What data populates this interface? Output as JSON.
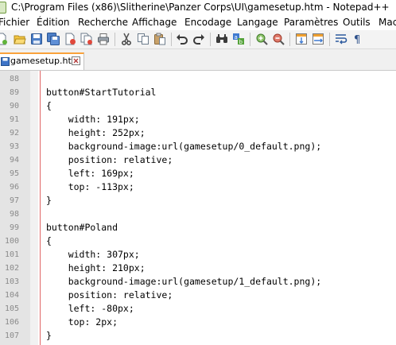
{
  "window": {
    "title": "C:\\Program Files (x86)\\Slitherine\\Panzer Corps\\UI\\gamesetup.htm - Notepad++"
  },
  "menu": {
    "items": [
      {
        "label": "Fichier"
      },
      {
        "label": "Édition"
      },
      {
        "label": "Recherche"
      },
      {
        "label": "Affichage"
      },
      {
        "label": "Encodage"
      },
      {
        "label": "Langage"
      },
      {
        "label": "Paramètres"
      },
      {
        "label": "Outils"
      },
      {
        "label": "Macro"
      }
    ]
  },
  "toolbar": {
    "icons": [
      "new-file-icon",
      "open-file-icon",
      "save-icon",
      "save-all-icon",
      "close-icon",
      "close-all-icon",
      "print-icon",
      "cut-icon",
      "copy-icon",
      "paste-icon",
      "undo-icon",
      "redo-icon",
      "find-icon",
      "replace-icon",
      "zoom-in-icon",
      "zoom-out-icon",
      "sync-vertical-icon",
      "sync-horizontal-icon",
      "word-wrap-icon",
      "show-all-chars-icon"
    ]
  },
  "tabs": [
    {
      "label": "gamesetup.htm",
      "active": true
    }
  ],
  "colors": {
    "accent_tab": "#f9a23b",
    "edge_line": "#e06464",
    "gutter": "#e4e4e4"
  },
  "editor": {
    "lines": [
      {
        "num": "88",
        "text": ""
      },
      {
        "num": "89",
        "text": "button#StartTutorial"
      },
      {
        "num": "90",
        "text": "{"
      },
      {
        "num": "91",
        "text": "    width: 191px;"
      },
      {
        "num": "92",
        "text": "    height: 252px;"
      },
      {
        "num": "93",
        "text": "    background-image:url(gamesetup/0_default.png);"
      },
      {
        "num": "94",
        "text": "    position: relative;"
      },
      {
        "num": "95",
        "text": "    left: 169px;"
      },
      {
        "num": "96",
        "text": "    top: -113px;"
      },
      {
        "num": "97",
        "text": "}"
      },
      {
        "num": "98",
        "text": ""
      },
      {
        "num": "99",
        "text": "button#Poland"
      },
      {
        "num": "100",
        "text": "{"
      },
      {
        "num": "101",
        "text": "    width: 307px;"
      },
      {
        "num": "102",
        "text": "    height: 210px;"
      },
      {
        "num": "103",
        "text": "    background-image:url(gamesetup/1_default.png);"
      },
      {
        "num": "104",
        "text": "    position: relative;"
      },
      {
        "num": "105",
        "text": "    left: -80px;"
      },
      {
        "num": "106",
        "text": "    top: 2px;"
      },
      {
        "num": "107",
        "text": "}"
      }
    ]
  }
}
